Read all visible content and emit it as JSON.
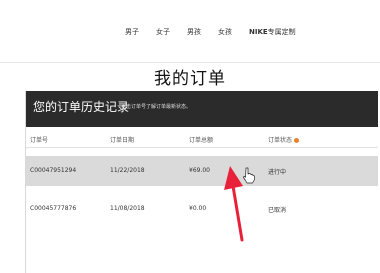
{
  "nav": {
    "items": [
      "男子",
      "女子",
      "男孩",
      "女孩"
    ],
    "custom_brand": "NIKE",
    "custom_rest": "专属定制"
  },
  "page_title": "我的订单",
  "panel": {
    "title": "您的订单历史记录",
    "subtitle": "点击订单号了解订单最新状态。"
  },
  "table": {
    "headers": [
      "订单号",
      "订单日期",
      "订单总额",
      "订单状态"
    ],
    "rows": [
      {
        "order_no": "C00047951294",
        "date": "11/22/2018",
        "total": "¥69.00",
        "status": "进行中"
      },
      {
        "order_no": "C00045777876",
        "date": "11/08/2018",
        "total": "¥0.00",
        "status": "已取消"
      }
    ]
  },
  "colors": {
    "header_bg": "#2b2b2b",
    "selected_row_bg": "#dadada",
    "arrow": "#e8203a",
    "info_dot": "#e8822b"
  },
  "icons": [
    "pointer-hand-icon",
    "info-icon",
    "red-arrow-annotation"
  ]
}
